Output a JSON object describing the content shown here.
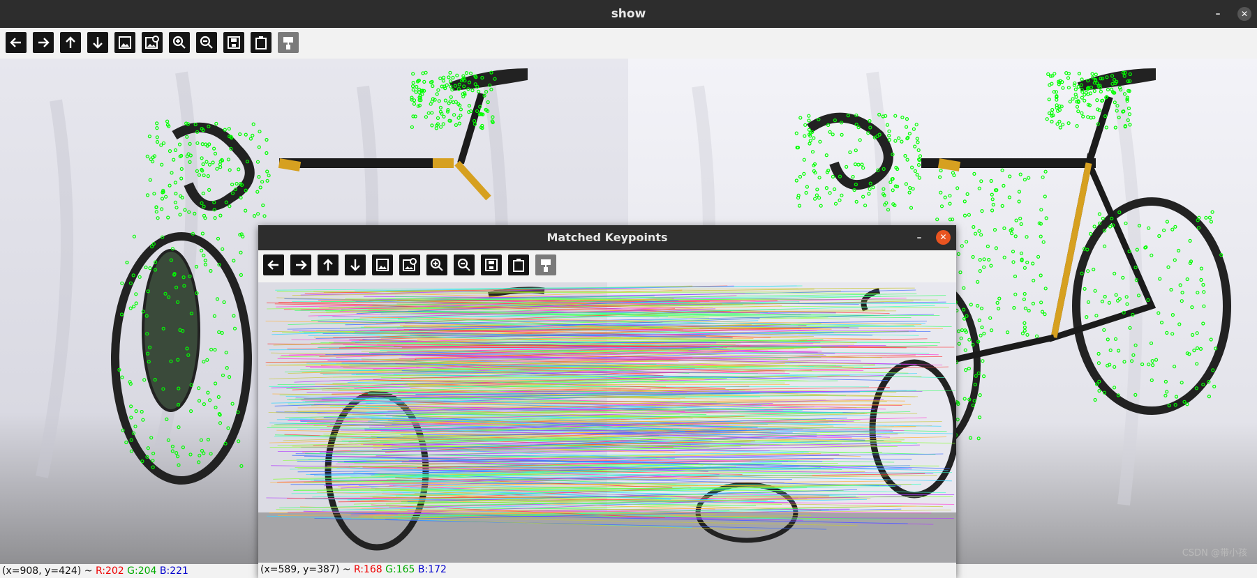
{
  "show_window": {
    "title": "show",
    "status": {
      "coords": "(x=908, y=424) ~ ",
      "r": "R:202",
      "g": "G:204",
      "b": "B:221"
    },
    "toolbar": [
      "pan-left",
      "pan-right",
      "pan-up",
      "pan-down",
      "zoom-original",
      "zoom-fit",
      "zoom-in",
      "zoom-out",
      "save",
      "copy-clipboard",
      "properties"
    ]
  },
  "match_window": {
    "title": "Matched Keypoints",
    "status": {
      "coords": "(x=589, y=387) ~ ",
      "r": "R:168",
      "g": "G:165",
      "b": "B:172"
    },
    "toolbar": [
      "pan-left",
      "pan-right",
      "pan-up",
      "pan-down",
      "zoom-original",
      "zoom-fit",
      "zoom-in",
      "zoom-out",
      "save",
      "copy-clipboard",
      "properties"
    ]
  },
  "watermark": "CSDN @带小孩",
  "colors": {
    "titlebar": "#2d2d2d",
    "close": "#e95420",
    "keypoint": "#00ff00",
    "frame_bg": "#f2f2f2"
  }
}
